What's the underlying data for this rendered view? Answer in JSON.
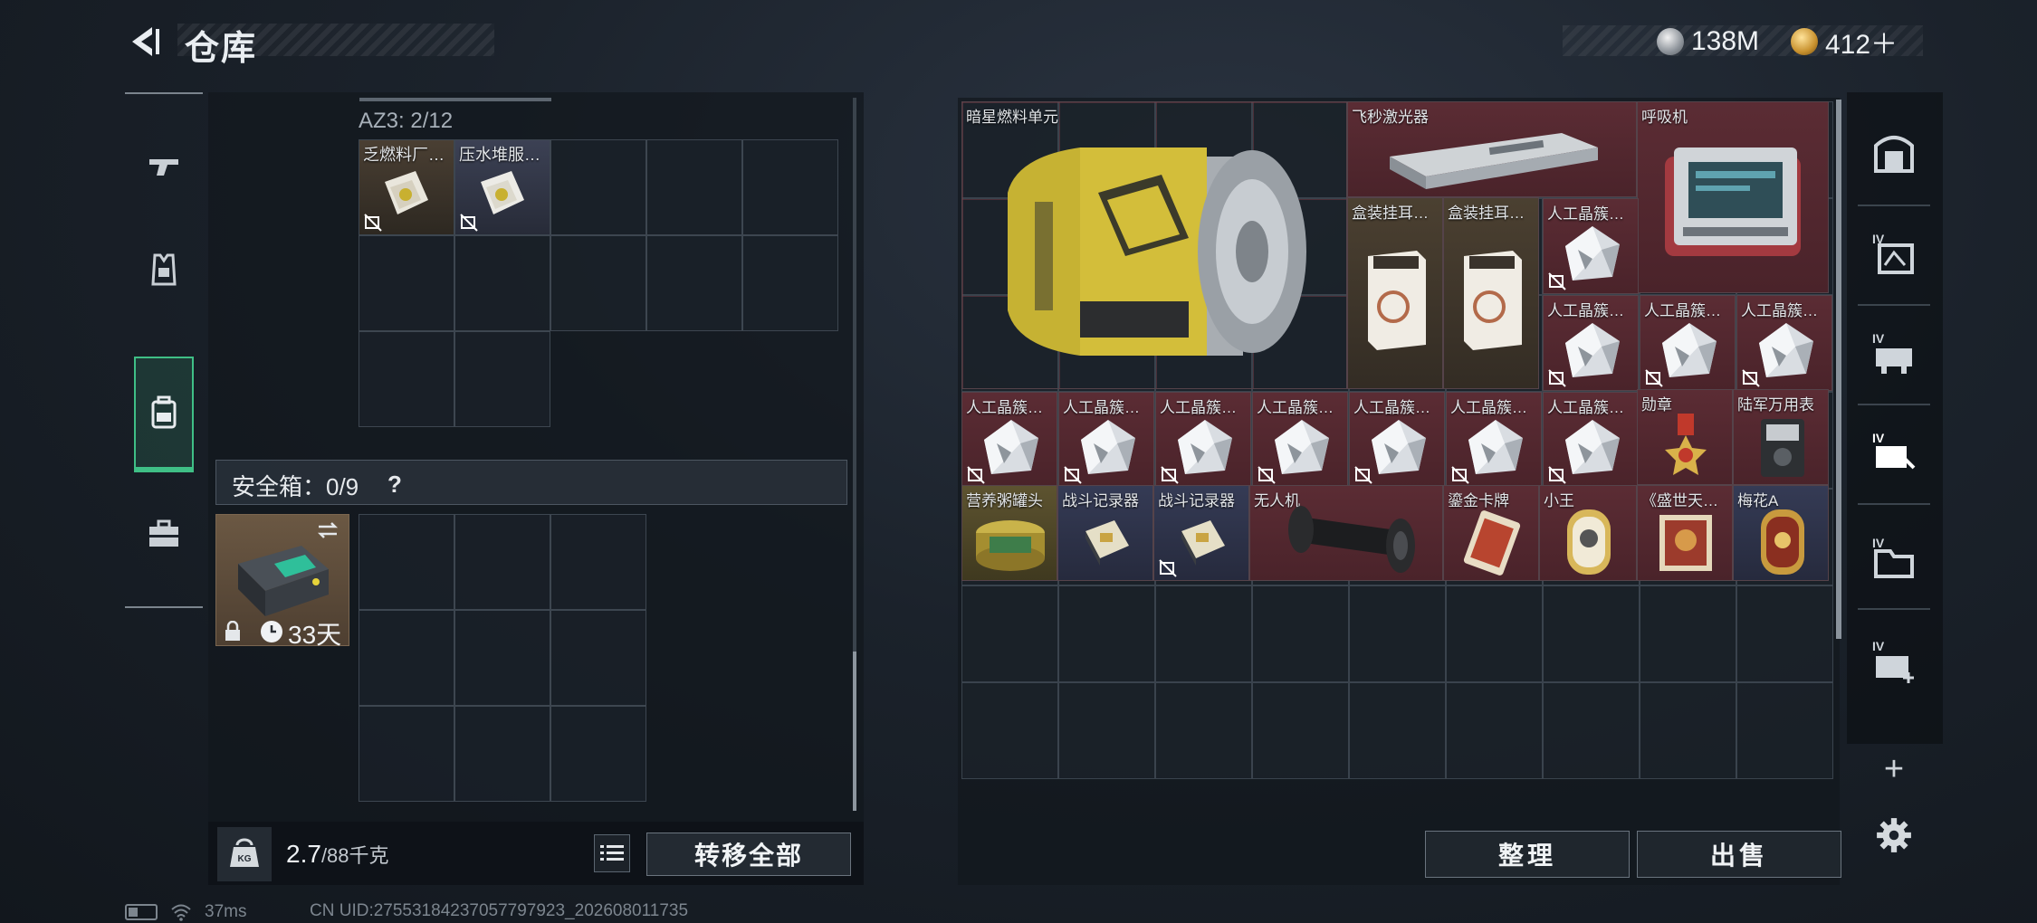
{
  "header": {
    "title": "仓库",
    "currency": [
      {
        "icon": "silver-coin-icon",
        "value": "138M"
      },
      {
        "icon": "gold-coin-icon",
        "value": "412＋"
      }
    ]
  },
  "left_rail": {
    "items": [
      {
        "name": "weapons",
        "icon": "pistol-icon"
      },
      {
        "name": "armor",
        "icon": "vest-icon"
      },
      {
        "name": "backpack",
        "icon": "backpack-icon",
        "selected": true
      },
      {
        "name": "toolbox",
        "icon": "briefcase-icon"
      }
    ]
  },
  "backpack": {
    "section_label": "AZ3: 2/12",
    "items": [
      {
        "name": "乏燃料厂…",
        "icon": "fuel-bag-icon",
        "locked": true
      },
      {
        "name": "压水堆服…",
        "icon": "reactor-bag-icon",
        "locked": true
      }
    ]
  },
  "safe_box": {
    "label": "安全箱：0/9",
    "help": "?",
    "timer": "33天",
    "icon": "safe-box-icon"
  },
  "weight": {
    "value": "2.7",
    "unit": "/88千克"
  },
  "buttons": {
    "transfer_all": "转移全部",
    "sort": "整理",
    "sell": "出售",
    "add": "+"
  },
  "stash": {
    "items": [
      {
        "name": "暗星燃料单元",
        "color": "red"
      },
      {
        "name": "飞秒激光器",
        "color": "red"
      },
      {
        "name": "呼吸机",
        "color": "red"
      },
      {
        "name": "盒装挂耳…",
        "color": "brown"
      },
      {
        "name": "盒装挂耳…",
        "color": "brown"
      },
      {
        "name": "人工晶簇…",
        "color": "red"
      },
      {
        "name": "人工晶簇…",
        "color": "red"
      },
      {
        "name": "人工晶簇…",
        "color": "red"
      },
      {
        "name": "人工晶簇…",
        "color": "red"
      },
      {
        "name": "人工晶簇…",
        "color": "red"
      },
      {
        "name": "人工晶簇…",
        "color": "red"
      },
      {
        "name": "人工晶簇…",
        "color": "red"
      },
      {
        "name": "人工晶簇…",
        "color": "red"
      },
      {
        "name": "人工晶簇…",
        "color": "red"
      },
      {
        "name": "人工晶簇…",
        "color": "red"
      },
      {
        "name": "人工晶簇…",
        "color": "red"
      },
      {
        "name": "勋章",
        "color": "red"
      },
      {
        "name": "陆军万用表",
        "color": "red"
      },
      {
        "name": "营养粥罐头",
        "color": "yellow"
      },
      {
        "name": "战斗记录器",
        "color": "blue"
      },
      {
        "name": "战斗记录器",
        "color": "blue"
      },
      {
        "name": "无人机",
        "color": "red"
      },
      {
        "name": "鎏金卡牌",
        "color": "red"
      },
      {
        "name": "小王",
        "color": "red"
      },
      {
        "name": "《盛世天…",
        "color": "red"
      },
      {
        "name": "梅花A",
        "color": "blue"
      }
    ]
  },
  "right_rail": {
    "items": [
      {
        "icon": "vault-door-icon"
      },
      {
        "icon": "container-iv-icon"
      },
      {
        "icon": "container-iv-icon"
      },
      {
        "icon": "container-iv-icon"
      },
      {
        "icon": "container-iv-icon"
      },
      {
        "icon": "container-iv-icon"
      }
    ],
    "settings_icon": "gear-icon"
  },
  "status": {
    "ping": "37ms",
    "uid": "CN UID:2755318423705779792​3_202608011735"
  },
  "colors": {
    "accent": "#3fbf86",
    "rarity_red": "#5b2c34",
    "rarity_blue": "#353b55",
    "rarity_brown": "#4b4031",
    "rarity_yellow": "#5d5330"
  }
}
